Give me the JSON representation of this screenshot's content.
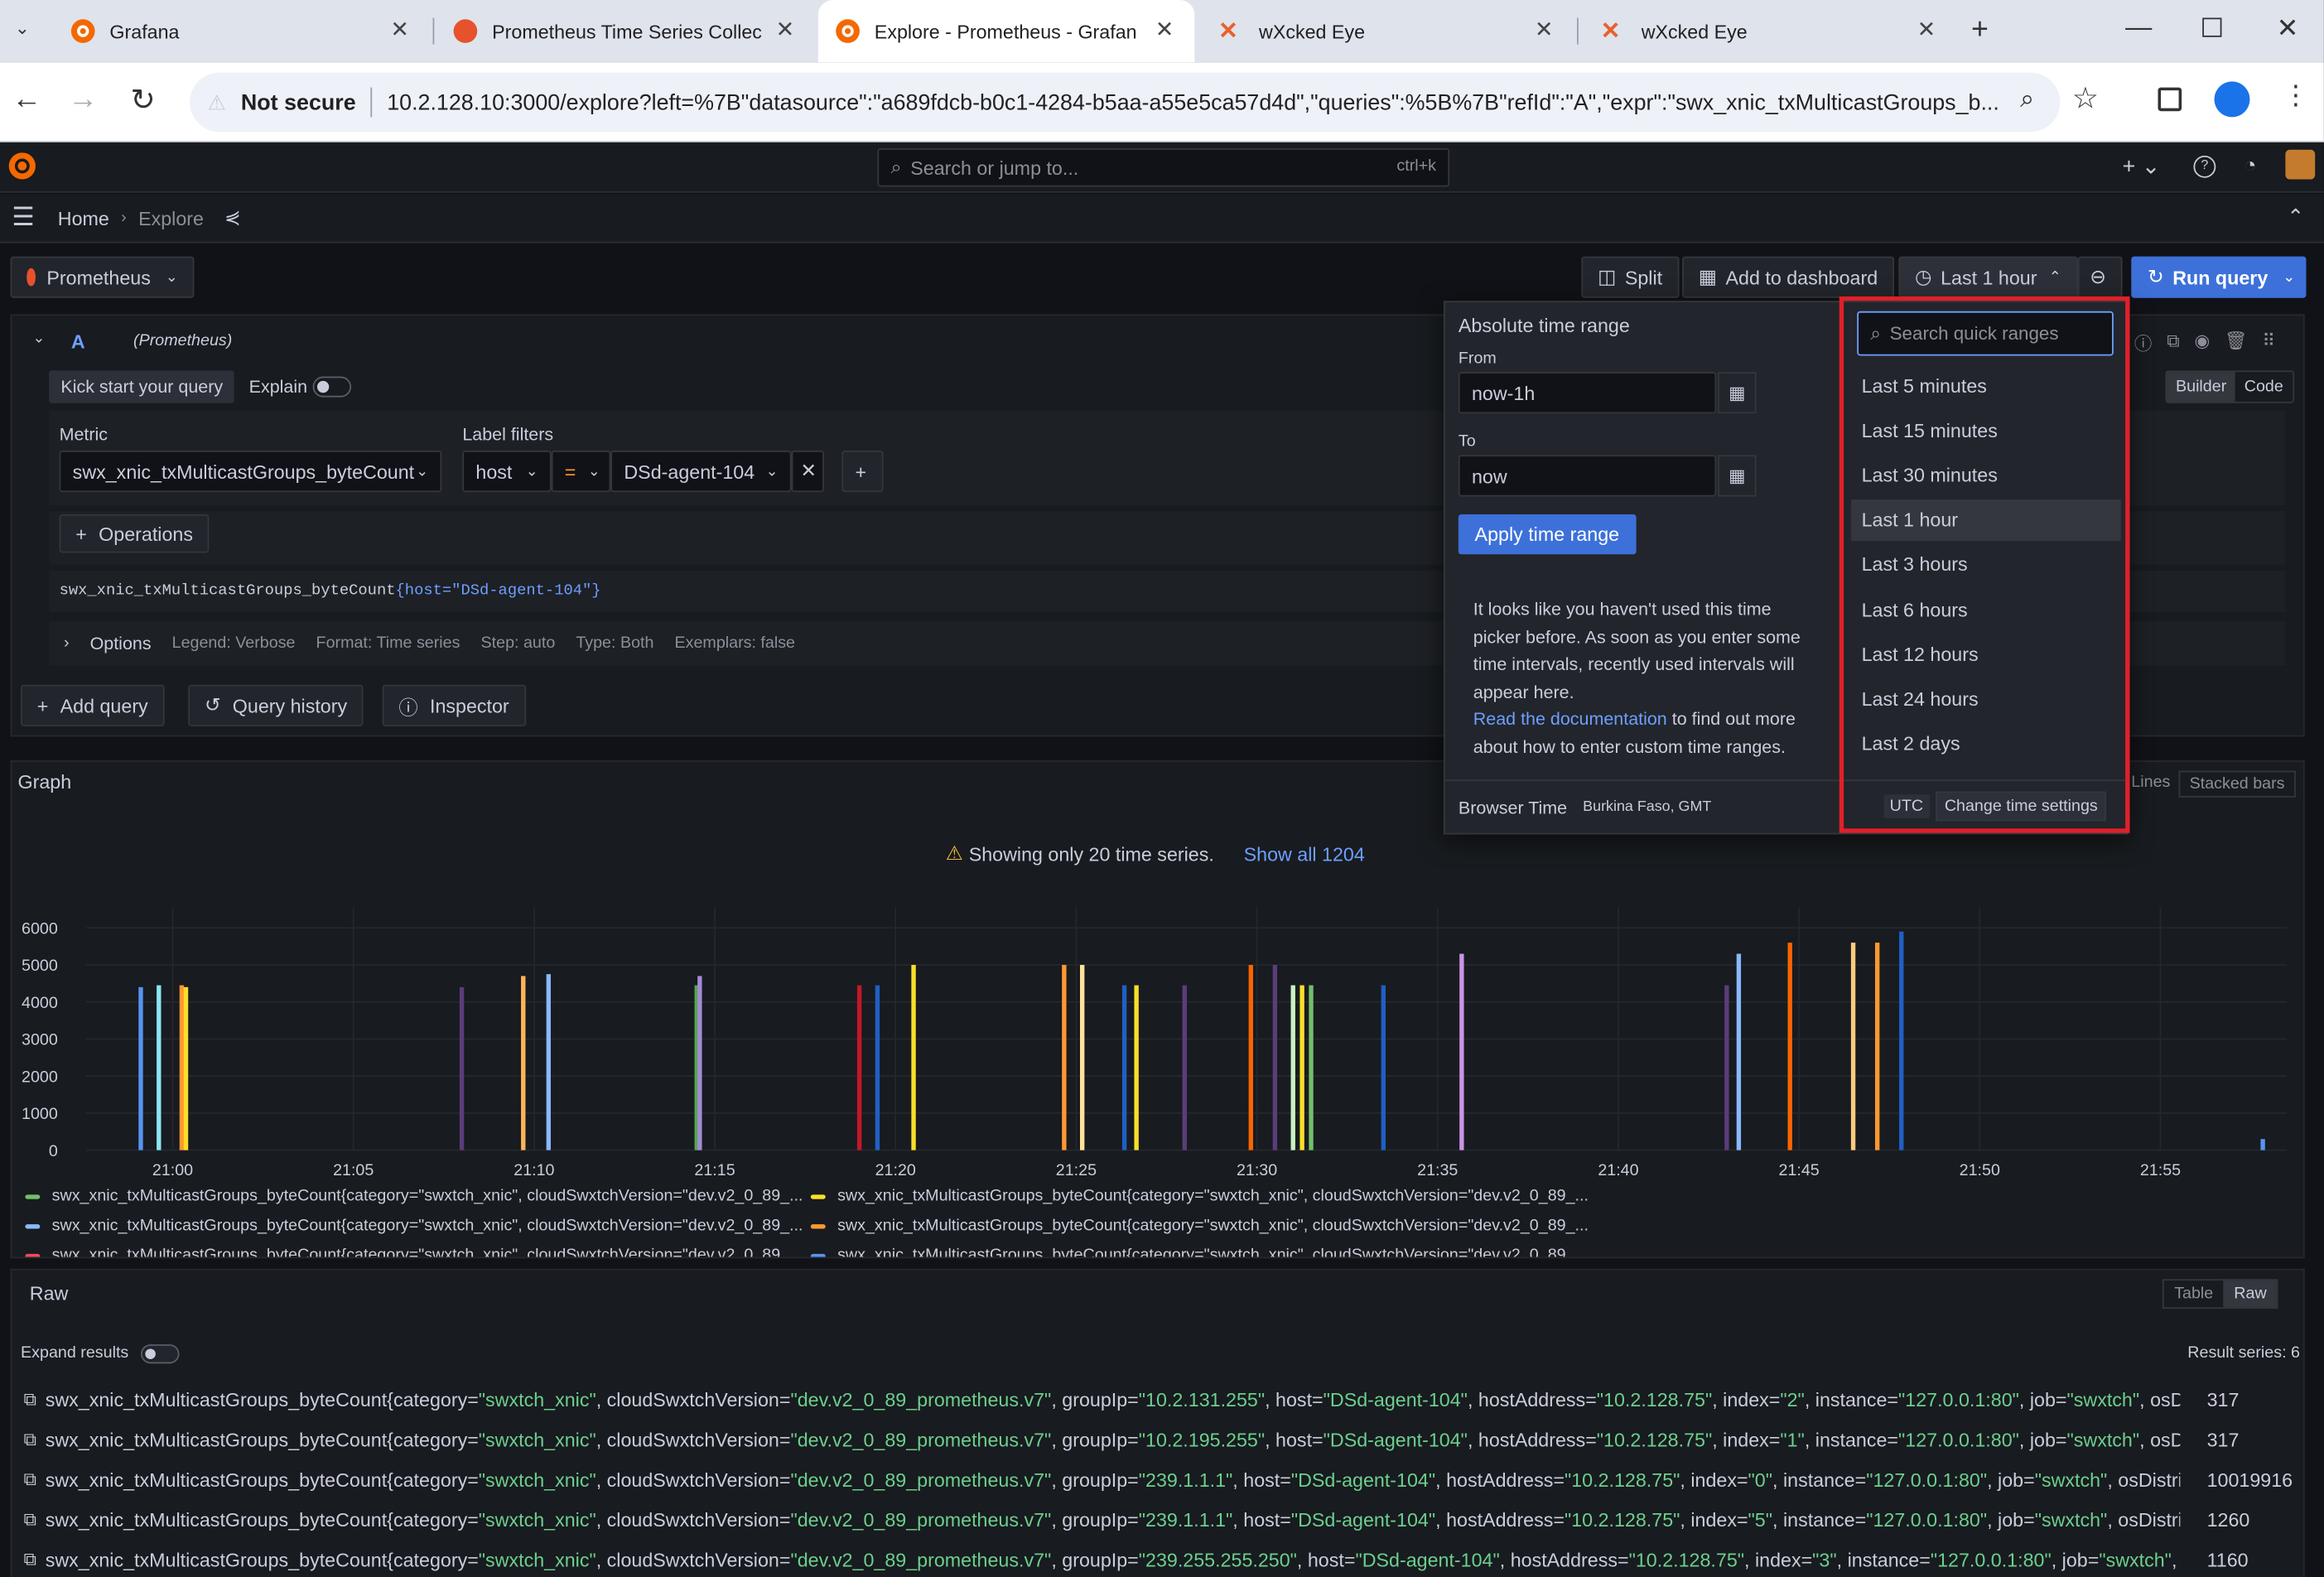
{
  "browser": {
    "tabs": [
      {
        "title": "Grafana",
        "icon": "grafana-favicon"
      },
      {
        "title": "Prometheus Time Series Collec",
        "icon": "prometheus-favicon"
      },
      {
        "title": "Explore - Prometheus - Grafan",
        "icon": "grafana-favicon",
        "active": true
      },
      {
        "title": "wXcked Eye",
        "icon": "wx-favicon"
      },
      {
        "title": "wXcked Eye",
        "icon": "wx-favicon"
      }
    ],
    "security_label": "Not secure",
    "url": "10.2.128.10:3000/explore?left=%7B\"datasource\":\"a689fdcb-b0c1-4284-b5aa-a55e5ca57d4d\",\"queries\":%5B%7B\"refId\":\"A\",\"expr\":\"swx_xnic_txMulticastGroups_b..."
  },
  "grafana": {
    "search_placeholder": "Search or jump to...",
    "search_shortcut": "ctrl+k",
    "breadcrumb": {
      "home": "Home",
      "current": "Explore"
    },
    "datasource": "Prometheus",
    "toolbar": {
      "split": "Split",
      "add_to_dashboard": "Add to dashboard",
      "time_range": "Last 1 hour",
      "run_query": "Run query"
    },
    "query": {
      "ref_id": "A",
      "ds_hint": "(Prometheus)",
      "kick_start": "Kick start your query",
      "explain": "Explain",
      "metric_label": "Metric",
      "metric_value": "swx_xnic_txMulticastGroups_byteCount",
      "label_filters_label": "Label filters",
      "filter_key": "host",
      "filter_op": "=",
      "filter_value": "DSd-agent-104",
      "operations": "Operations",
      "preview_metric": "swx_xnic_txMulticastGroups_byteCount",
      "preview_labels": "{host=\"DSd-agent-104\"}",
      "options_label": "Options",
      "legend": "Legend: Verbose",
      "format": "Format: Time series",
      "step": "Step: auto",
      "type": "Type: Both",
      "exemplars": "Exemplars: false",
      "builder": "Builder",
      "code": "Code"
    },
    "actions": {
      "add_query": "Add query",
      "query_history": "Query history",
      "inspector": "Inspector"
    },
    "graph": {
      "title": "Graph",
      "warning": "Showing only 20 time series.",
      "show_all": "Show all 1204",
      "lines_btn": "Lines",
      "stacked_bars": "Stacked bars",
      "legend": [
        {
          "label": "swx_xnic_txMulticastGroups_byteCount{category=\"swxtch_xnic\", cloudSwxtchVersion=\"dev.v2_0_89_...",
          "color": "#73bf69"
        },
        {
          "label": "swx_xnic_txMulticastGroups_byteCount{category=\"swxtch_xnic\", cloudSwxtchVersion=\"dev.v2_0_89_...",
          "color": "#fade2a"
        },
        {
          "label": "swx_xnic_txMulticastGroups_byteCount{category=\"swxtch_xnic\", cloudSwxtchVersion=\"dev.v2_0_89_...",
          "color": "#8ab8ff"
        },
        {
          "label": "swx_xnic_txMulticastGroups_byteCount{category=\"swxtch_xnic\", cloudSwxtchVersion=\"dev.v2_0_89_...",
          "color": "#ff9830"
        },
        {
          "label": "swx_xnic_txMulticastGroups_byteCount{category=\"swxtch_xnic\", cloudSwxtchVersion=\"dev.v2_0_89_...",
          "color": "#f2495c"
        },
        {
          "label": "swx_xnic_txMulticastGroups_byteCount{category=\"swxtch_xnic\", cloudSwxtchVersion=\"dev.v2_0_89_...",
          "color": "#5794f2"
        }
      ]
    },
    "raw": {
      "title": "Raw",
      "table_btn": "Table",
      "raw_btn": "Raw",
      "expand": "Expand results",
      "result_series": "Result series: 6",
      "rows": [
        {
          "groupIp": "10.2.131.255",
          "index": "2",
          "tail": "osDistrib",
          "value": "317"
        },
        {
          "groupIp": "10.2.195.255",
          "index": "1",
          "tail": "osDistrib",
          "value": "317"
        },
        {
          "groupIp": "239.1.1.1",
          "index": "0",
          "tail": "osDistribution",
          "value": "10019916"
        },
        {
          "groupIp": "239.1.1.1",
          "index": "5",
          "tail": "osDistribution",
          "value": "1260"
        },
        {
          "groupIp": "239.255.255.250",
          "index": "3",
          "tail": "osDi",
          "value": "1160"
        }
      ],
      "row_metric": "swx_xnic_txMulticastGroups_byteCount",
      "row_fixed": {
        "category": "swxtch_xnic",
        "cloudSwxtchVersion": "dev.v2_0_89_prometheus.v7",
        "host": "DSd-agent-104",
        "hostAddress": "10.2.128.75",
        "instance": "127.0.0.1:80",
        "job": "swxtch"
      }
    },
    "time_picker": {
      "absolute_title": "Absolute time range",
      "from_label": "From",
      "from_value": "now-1h",
      "to_label": "To",
      "to_value": "now",
      "apply": "Apply time range",
      "info": "It looks like you haven't used this time picker before. As soon as you enter some time intervals, recently used intervals will appear here.",
      "doc_link": "Read the documentation",
      "doc_tail": " to find out more about how to enter custom time ranges.",
      "browser_time": "Browser Time",
      "tz": "Burkina Faso, GMT",
      "utc": "UTC",
      "change_settings": "Change time settings",
      "search_placeholder": "Search quick ranges",
      "quick_ranges": [
        "Last 5 minutes",
        "Last 15 minutes",
        "Last 30 minutes",
        "Last 1 hour",
        "Last 3 hours",
        "Last 6 hours",
        "Last 12 hours",
        "Last 24 hours",
        "Last 2 days"
      ],
      "selected": "Last 1 hour"
    }
  },
  "chart_data": {
    "type": "bar",
    "y_ticks": [
      "6000",
      "5000",
      "4000",
      "3000",
      "2000",
      "1000",
      "0"
    ],
    "x_ticks": [
      "21:00",
      "21:05",
      "21:10",
      "21:15",
      "21:20",
      "21:25",
      "21:30",
      "21:35",
      "21:40",
      "21:45",
      "21:50",
      "21:55"
    ],
    "ylim": [
      0,
      6000
    ],
    "bars": [
      {
        "x": "20:59:07",
        "y": 4400,
        "color": "#5794f2"
      },
      {
        "x": "20:59:37",
        "y": 4450,
        "color": "#8ae6f2"
      },
      {
        "x": "21:00:15",
        "y": 4450,
        "color": "#ff9830"
      },
      {
        "x": "21:00:22",
        "y": 4400,
        "color": "#fade2a"
      },
      {
        "x": "21:08:00",
        "y": 4400,
        "color": "#5a3d7a"
      },
      {
        "x": "21:09:42",
        "y": 4700,
        "color": "#ffb357"
      },
      {
        "x": "21:10:24",
        "y": 4750,
        "color": "#8ab8ff"
      },
      {
        "x": "21:14:30",
        "y": 4450,
        "color": "#56a64b"
      },
      {
        "x": "21:14:35",
        "y": 4700,
        "color": "#a38bd8"
      },
      {
        "x": "21:19:00",
        "y": 4450,
        "color": "#c4162a"
      },
      {
        "x": "21:19:30",
        "y": 4450,
        "color": "#1f60c4"
      },
      {
        "x": "21:20:30",
        "y": 5000,
        "color": "#fade2a"
      },
      {
        "x": "21:24:40",
        "y": 5000,
        "color": "#ff9830"
      },
      {
        "x": "21:25:10",
        "y": 5000,
        "color": "#ffe29a"
      },
      {
        "x": "21:26:20",
        "y": 4450,
        "color": "#1f60c4"
      },
      {
        "x": "21:26:40",
        "y": 4450,
        "color": "#fade2a"
      },
      {
        "x": "21:28:00",
        "y": 4450,
        "color": "#5a3d7a"
      },
      {
        "x": "21:29:50",
        "y": 5000,
        "color": "#fa6400"
      },
      {
        "x": "21:30:30",
        "y": 5000,
        "color": "#5a3d7a"
      },
      {
        "x": "21:31:00",
        "y": 4450,
        "color": "#c8f2c2"
      },
      {
        "x": "21:31:15",
        "y": 4450,
        "color": "#fade2a"
      },
      {
        "x": "21:31:30",
        "y": 4450,
        "color": "#73bf69"
      },
      {
        "x": "21:33:30",
        "y": 4450,
        "color": "#1f60c4"
      },
      {
        "x": "21:35:40",
        "y": 5300,
        "color": "#ca95e5"
      },
      {
        "x": "21:43:00",
        "y": 4450,
        "color": "#5a3d7a"
      },
      {
        "x": "21:43:20",
        "y": 5300,
        "color": "#8ab8ff"
      },
      {
        "x": "21:44:45",
        "y": 5600,
        "color": "#fa6400"
      },
      {
        "x": "21:46:30",
        "y": 5600,
        "color": "#ffcb7d"
      },
      {
        "x": "21:47:10",
        "y": 5600,
        "color": "#ff9830"
      },
      {
        "x": "21:47:50",
        "y": 5900,
        "color": "#1f60c4"
      },
      {
        "x": "21:57:50",
        "y": 300,
        "color": "#5794f2"
      }
    ]
  }
}
